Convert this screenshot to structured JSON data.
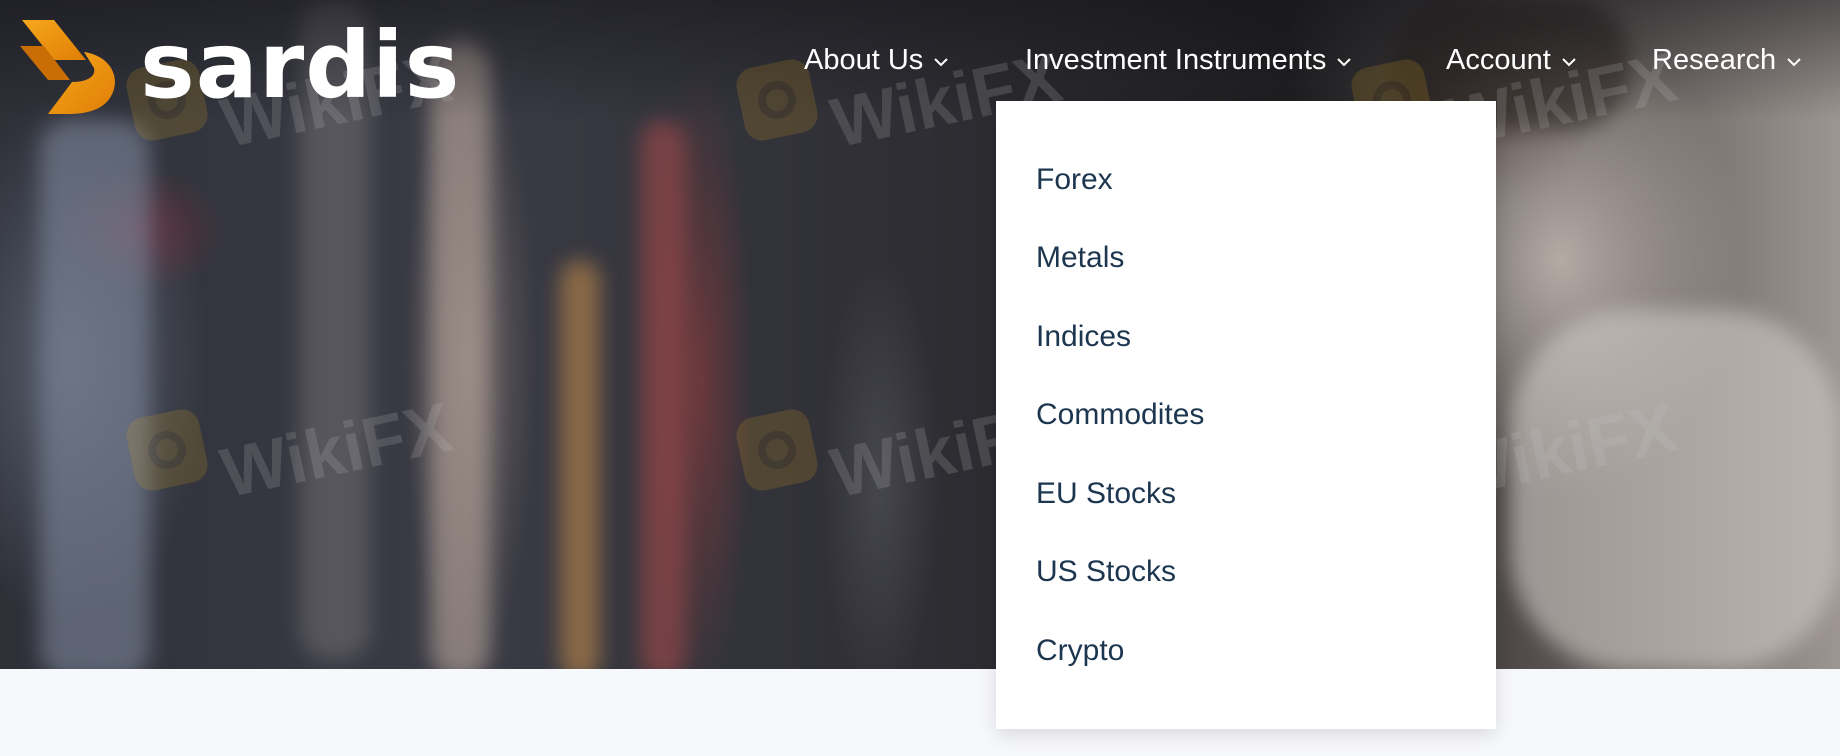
{
  "brand": {
    "name": "sardis",
    "accent_orange": "#f29a11"
  },
  "nav": {
    "items": [
      {
        "label": "About Us",
        "icon": "chevron-down-icon"
      },
      {
        "label": "Investment Instruments",
        "icon": "chevron-down-icon"
      },
      {
        "label": "Account",
        "icon": "chevron-down-icon"
      },
      {
        "label": "Research",
        "icon": "chevron-down-icon"
      }
    ]
  },
  "dropdown": {
    "parent": "Investment Instruments",
    "items": [
      "Forex",
      "Metals",
      "Indices",
      "Commodites",
      "EU Stocks",
      "US Stocks",
      "Crypto"
    ]
  },
  "watermark": {
    "text": "WikiFX",
    "icon": "wikifx-logo-icon"
  },
  "colors": {
    "menu_text": "#1d3650",
    "nav_text": "#ffffff",
    "page_bg": "#f7f8fc"
  }
}
